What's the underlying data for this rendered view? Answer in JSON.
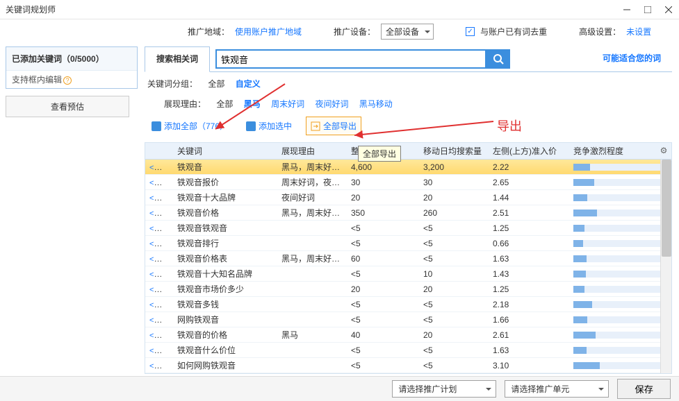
{
  "window": {
    "title": "关键词规划师"
  },
  "toolbar": {
    "region_label": "推广地域：",
    "region_value": "使用账户推广地域",
    "device_label": "推广设备：",
    "device_value": "全部设备",
    "dedup_label": "与账户已有词去重",
    "adv_label": "高级设置：",
    "adv_value": "未设置"
  },
  "left": {
    "header": "已添加关键词（0/5000）",
    "sub": "支持框内编辑",
    "preview": "查看预估"
  },
  "tabs": {
    "search_tab": "搜索相关词",
    "search_value": "铁观音",
    "suggest_tab": "可能适合您的词"
  },
  "filters": {
    "group_label": "关键词分组：",
    "all": "全部",
    "custom": "自定义",
    "reason_label": "展现理由：",
    "r_black": "黑马",
    "r_weekend": "周末好词",
    "r_night": "夜间好词",
    "r_blackmove": "黑马移动"
  },
  "actions": {
    "add_all": "添加全部（776）",
    "add_selected": "添加选中",
    "export_all": "全部导出",
    "tooltip": "全部导出"
  },
  "annotation": {
    "export": "导出"
  },
  "table": {
    "headers": {
      "kw": "关键词",
      "reason": "展现理由",
      "v1": "整体",
      "v2": "移动日均搜索量",
      "v3": "左侧(上方)准入价",
      "comp": "竞争激烈程度"
    },
    "add_label": "<添加",
    "rows": [
      {
        "kw": "铁观音",
        "reason": "黑马，周末好…",
        "v1": "4,600",
        "v2": "3,200",
        "v3": "2.22",
        "comp": 18,
        "selected": true
      },
      {
        "kw": "铁观音报价",
        "reason": "周末好词，夜…",
        "v1": "30",
        "v2": "30",
        "v3": "2.65",
        "comp": 22
      },
      {
        "kw": "铁观音十大品牌",
        "reason": "夜间好词",
        "v1": "20",
        "v2": "20",
        "v3": "1.44",
        "comp": 15
      },
      {
        "kw": "铁观音价格",
        "reason": "黑马，周末好…",
        "v1": "350",
        "v2": "260",
        "v3": "2.51",
        "comp": 25
      },
      {
        "kw": "铁观音铁观音",
        "reason": "",
        "v1": "<5",
        "v2": "<5",
        "v3": "1.25",
        "comp": 12
      },
      {
        "kw": "铁观音排行",
        "reason": "",
        "v1": "<5",
        "v2": "<5",
        "v3": "0.66",
        "comp": 10
      },
      {
        "kw": "铁观音价格表",
        "reason": "黑马，周末好…",
        "v1": "60",
        "v2": "<5",
        "v3": "1.63",
        "comp": 14
      },
      {
        "kw": "铁观音十大知名品牌",
        "reason": "",
        "v1": "<5",
        "v2": "10",
        "v3": "1.43",
        "comp": 13
      },
      {
        "kw": "铁观音市场价多少",
        "reason": "",
        "v1": "20",
        "v2": "20",
        "v3": "1.25",
        "comp": 12
      },
      {
        "kw": "铁观音多钱",
        "reason": "",
        "v1": "<5",
        "v2": "<5",
        "v3": "2.18",
        "comp": 20
      },
      {
        "kw": "网购铁观音",
        "reason": "",
        "v1": "<5",
        "v2": "<5",
        "v3": "1.66",
        "comp": 15
      },
      {
        "kw": "铁观音的价格",
        "reason": "黑马",
        "v1": "40",
        "v2": "20",
        "v3": "2.61",
        "comp": 24
      },
      {
        "kw": "铁观音什么价位",
        "reason": "",
        "v1": "<5",
        "v2": "<5",
        "v3": "1.63",
        "comp": 14
      },
      {
        "kw": "如何网购铁观音",
        "reason": "",
        "v1": "<5",
        "v2": "<5",
        "v3": "3.10",
        "comp": 28
      }
    ]
  },
  "bottom": {
    "plan": "请选择推广计划",
    "unit": "请选择推广单元",
    "save": "保存"
  }
}
